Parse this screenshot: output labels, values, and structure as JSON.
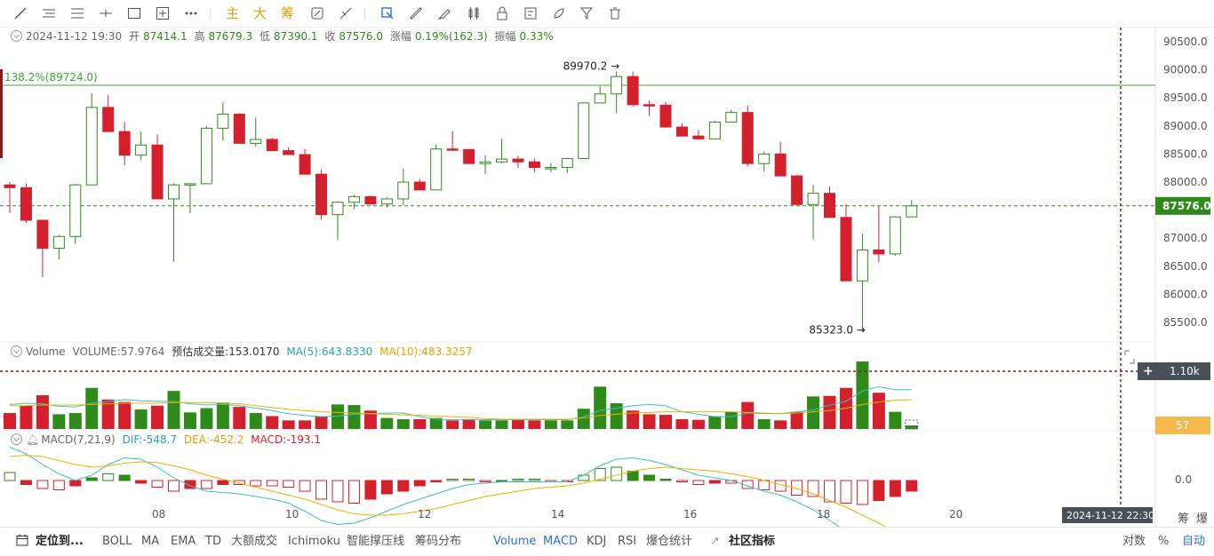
{
  "toolbar": {
    "text_buttons": [
      "主",
      "大",
      "筹"
    ],
    "icons": [
      "line-tool-icon",
      "parallel-lines-icon",
      "horizontal-lines-icon",
      "cross-line-icon",
      "rectangle-icon",
      "plus-box-icon",
      "more-icon",
      "magnet-icon",
      "ruler-icon",
      "cursor-icon",
      "copy-icon",
      "link-icon",
      "brush-icon",
      "candles-icon",
      "lock-icon",
      "edit-icon",
      "highlighter-icon",
      "filter-icon",
      "trash-icon"
    ]
  },
  "ohlc_info": {
    "date": "2024-11-12 19:30",
    "open_label": "开",
    "open": "87414.1",
    "high_label": "高",
    "high": "87679.3",
    "low_label": "低",
    "low": "87390.1",
    "close_label": "收",
    "close": "87576.0",
    "change_label": "涨幅",
    "change": "0.19%(162.3)",
    "amplitude_label": "振幅",
    "amplitude": "0.33%"
  },
  "volume_info": {
    "title": "Volume",
    "volume": "VOLUME:57.9764",
    "estimated": "预估成交量:153.0170",
    "ma5": "MA(5):643.8330",
    "ma10": "MA(10):483.3257"
  },
  "macd_info": {
    "title": "MACD(7,21,9)",
    "dif": "DIF:-548.7",
    "dea": "DEA:-452.2",
    "macd": "MACD:-193.1"
  },
  "price_axis": {
    "ticks": [
      "90500.0",
      "90000.0",
      "89500.0",
      "89000.0",
      "88500.0",
      "88000.0",
      "87500.0",
      "87000.0",
      "86500.0",
      "86000.0",
      "85500.0"
    ],
    "current_price": "87576.0"
  },
  "annotations": {
    "fib_label": "138.2%(89724.0)",
    "high_marker": "89970.2",
    "low_marker": "85323.0"
  },
  "volume_axis": {
    "crosshair_value": "1.10k",
    "current_value": "57"
  },
  "macd_axis": {
    "zero": "0.0"
  },
  "time_axis": {
    "labels": [
      "08",
      "10",
      "12",
      "14",
      "16",
      "18",
      "20"
    ],
    "crosshair_time": "2024-11-12 22:30"
  },
  "right_controls": {
    "chip": "筹",
    "burst": "爆",
    "log": "对数",
    "percent": "%",
    "auto": "自动"
  },
  "bottom_bar": {
    "locate": "定位到...",
    "indicators": [
      "BOLL",
      "MA",
      "EMA",
      "TD",
      "大额成交",
      "Ichimoku",
      "智能撑压线",
      "筹码分布"
    ],
    "sub_indicators": [
      "Volume",
      "MACD",
      "KDJ",
      "RSI",
      "爆仓统计"
    ],
    "community": "社区指标"
  },
  "colors": {
    "up": "#2e8b1a",
    "down": "#d4202c",
    "ma5": "#3bc1c1",
    "ma10": "#f0b000",
    "fib": "#3aaa35",
    "crosshair": "#8b1a1a"
  },
  "chart_data": {
    "type": "candlestick",
    "x_labels": [
      "08",
      "10",
      "12",
      "14",
      "16",
      "18",
      "20"
    ],
    "y_range": [
      85300,
      90600
    ],
    "candles": [
      {
        "o": 87950,
        "h": 88000,
        "l": 87450,
        "c": 87900
      },
      {
        "o": 87900,
        "h": 87970,
        "l": 87270,
        "c": 87320
      },
      {
        "o": 87320,
        "h": 87330,
        "l": 86310,
        "c": 86820
      },
      {
        "o": 86820,
        "h": 87060,
        "l": 86620,
        "c": 87030
      },
      {
        "o": 87030,
        "h": 87970,
        "l": 86900,
        "c": 87950
      },
      {
        "o": 87950,
        "h": 89580,
        "l": 87950,
        "c": 89330
      },
      {
        "o": 89330,
        "h": 89550,
        "l": 88900,
        "c": 88900
      },
      {
        "o": 88900,
        "h": 89070,
        "l": 88300,
        "c": 88480
      },
      {
        "o": 88480,
        "h": 88900,
        "l": 88390,
        "c": 88660
      },
      {
        "o": 88660,
        "h": 88850,
        "l": 87700,
        "c": 87700
      },
      {
        "o": 87700,
        "h": 87980,
        "l": 86580,
        "c": 87950
      },
      {
        "o": 87950,
        "h": 87980,
        "l": 87450,
        "c": 87970
      },
      {
        "o": 87970,
        "h": 89000,
        "l": 87970,
        "c": 88960
      },
      {
        "o": 88960,
        "h": 89430,
        "l": 88740,
        "c": 89210
      },
      {
        "o": 89210,
        "h": 89230,
        "l": 88690,
        "c": 88690
      },
      {
        "o": 88690,
        "h": 89150,
        "l": 88630,
        "c": 88760
      },
      {
        "o": 88760,
        "h": 88790,
        "l": 88560,
        "c": 88560
      },
      {
        "o": 88560,
        "h": 88620,
        "l": 88510,
        "c": 88490
      },
      {
        "o": 88490,
        "h": 88590,
        "l": 88140,
        "c": 88140
      },
      {
        "o": 88140,
        "h": 88220,
        "l": 87330,
        "c": 87420
      },
      {
        "o": 87420,
        "h": 87660,
        "l": 86970,
        "c": 87640
      },
      {
        "o": 87640,
        "h": 87770,
        "l": 87520,
        "c": 87740
      },
      {
        "o": 87740,
        "h": 87760,
        "l": 87600,
        "c": 87610
      },
      {
        "o": 87610,
        "h": 87730,
        "l": 87550,
        "c": 87700
      },
      {
        "o": 87700,
        "h": 88240,
        "l": 87590,
        "c": 88000
      },
      {
        "o": 88000,
        "h": 88050,
        "l": 87850,
        "c": 87860
      },
      {
        "o": 87860,
        "h": 88670,
        "l": 87860,
        "c": 88590
      },
      {
        "o": 88590,
        "h": 88910,
        "l": 88550,
        "c": 88580
      },
      {
        "o": 88580,
        "h": 88580,
        "l": 88330,
        "c": 88330
      },
      {
        "o": 88330,
        "h": 88480,
        "l": 88140,
        "c": 88360
      },
      {
        "o": 88360,
        "h": 88770,
        "l": 88330,
        "c": 88410
      },
      {
        "o": 88410,
        "h": 88470,
        "l": 88250,
        "c": 88360
      },
      {
        "o": 88360,
        "h": 88420,
        "l": 88170,
        "c": 88260
      },
      {
        "o": 88260,
        "h": 88340,
        "l": 88180,
        "c": 88260
      },
      {
        "o": 88260,
        "h": 88430,
        "l": 88160,
        "c": 88420
      },
      {
        "o": 88420,
        "h": 89420,
        "l": 88420,
        "c": 89410
      },
      {
        "o": 89410,
        "h": 89710,
        "l": 89400,
        "c": 89570
      },
      {
        "o": 89570,
        "h": 89970,
        "l": 89230,
        "c": 89880
      },
      {
        "o": 89880,
        "h": 89970,
        "l": 89340,
        "c": 89380
      },
      {
        "o": 89380,
        "h": 89450,
        "l": 89180,
        "c": 89370
      },
      {
        "o": 89370,
        "h": 89430,
        "l": 88970,
        "c": 88980
      },
      {
        "o": 88980,
        "h": 89050,
        "l": 88850,
        "c": 88820
      },
      {
        "o": 88820,
        "h": 88930,
        "l": 88800,
        "c": 88770
      },
      {
        "o": 88770,
        "h": 89090,
        "l": 88770,
        "c": 89070
      },
      {
        "o": 89070,
        "h": 89290,
        "l": 89060,
        "c": 89240
      },
      {
        "o": 89240,
        "h": 89360,
        "l": 88280,
        "c": 88330
      },
      {
        "o": 88330,
        "h": 88550,
        "l": 88190,
        "c": 88500
      },
      {
        "o": 88500,
        "h": 88720,
        "l": 88110,
        "c": 88110
      },
      {
        "o": 88110,
        "h": 88130,
        "l": 87600,
        "c": 87600
      },
      {
        "o": 87600,
        "h": 87950,
        "l": 86980,
        "c": 87800
      },
      {
        "o": 87800,
        "h": 87920,
        "l": 87360,
        "c": 87370
      },
      {
        "o": 87370,
        "h": 87610,
        "l": 86240,
        "c": 86240
      },
      {
        "o": 86240,
        "h": 87080,
        "l": 85330,
        "c": 86790
      },
      {
        "o": 86790,
        "h": 87570,
        "l": 86570,
        "c": 86720
      },
      {
        "o": 86720,
        "h": 87370,
        "l": 86690,
        "c": 87380
      },
      {
        "o": 87380,
        "h": 87680,
        "l": 87390,
        "c": 87576
      }
    ],
    "volume": [
      0.26,
      0.38,
      0.55,
      0.24,
      0.26,
      0.67,
      0.48,
      0.44,
      0.32,
      0.38,
      0.62,
      0.27,
      0.34,
      0.43,
      0.36,
      0.26,
      0.21,
      0.14,
      0.14,
      0.21,
      0.4,
      0.39,
      0.3,
      0.18,
      0.16,
      0.16,
      0.18,
      0.14,
      0.16,
      0.14,
      0.14,
      0.16,
      0.14,
      0.14,
      0.14,
      0.33,
      0.69,
      0.42,
      0.3,
      0.24,
      0.23,
      0.16,
      0.15,
      0.21,
      0.28,
      0.44,
      0.16,
      0.14,
      0.28,
      0.53,
      0.54,
      0.67,
      1.1,
      0.59,
      0.28,
      0.058
    ],
    "volume_ma5": [
      0.4,
      0.42,
      0.41,
      0.37,
      0.36,
      0.42,
      0.45,
      0.48,
      0.46,
      0.45,
      0.45,
      0.41,
      0.39,
      0.4,
      0.38,
      0.34,
      0.3,
      0.25,
      0.22,
      0.2,
      0.21,
      0.24,
      0.25,
      0.26,
      0.26,
      0.2,
      0.16,
      0.15,
      0.15,
      0.15,
      0.15,
      0.15,
      0.15,
      0.15,
      0.15,
      0.2,
      0.3,
      0.34,
      0.38,
      0.4,
      0.38,
      0.28,
      0.24,
      0.2,
      0.2,
      0.26,
      0.25,
      0.25,
      0.28,
      0.31,
      0.39,
      0.45,
      0.62,
      0.69,
      0.64,
      0.64
    ],
    "volume_ma10": [
      0.38,
      0.38,
      0.39,
      0.39,
      0.39,
      0.4,
      0.41,
      0.42,
      0.42,
      0.42,
      0.43,
      0.43,
      0.43,
      0.42,
      0.41,
      0.38,
      0.35,
      0.32,
      0.3,
      0.28,
      0.27,
      0.26,
      0.25,
      0.24,
      0.23,
      0.22,
      0.21,
      0.2,
      0.19,
      0.17,
      0.16,
      0.16,
      0.16,
      0.16,
      0.16,
      0.18,
      0.22,
      0.24,
      0.26,
      0.27,
      0.28,
      0.28,
      0.28,
      0.28,
      0.28,
      0.27,
      0.26,
      0.25,
      0.26,
      0.28,
      0.3,
      0.34,
      0.4,
      0.44,
      0.47,
      0.48
    ],
    "macd_hist": [
      60,
      -30,
      -60,
      -70,
      -40,
      20,
      50,
      40,
      -20,
      -50,
      -80,
      -60,
      -60,
      -30,
      -30,
      -40,
      -40,
      -50,
      -80,
      -140,
      -160,
      -170,
      -140,
      -100,
      -80,
      -40,
      -10,
      10,
      10,
      -10,
      0,
      10,
      10,
      -10,
      -10,
      40,
      90,
      100,
      70,
      40,
      10,
      -10,
      -30,
      -20,
      -20,
      -60,
      -70,
      -80,
      -110,
      -120,
      -160,
      -170,
      -180,
      -150,
      -120,
      -80
    ],
    "macd_dif": [
      250,
      200,
      120,
      50,
      0,
      40,
      120,
      170,
      160,
      100,
      20,
      -40,
      -80,
      -90,
      -100,
      -120,
      -140,
      -170,
      -230,
      -300,
      -330,
      -320,
      -280,
      -230,
      -180,
      -140,
      -100,
      -60,
      -30,
      -20,
      -10,
      -10,
      -10,
      -10,
      -10,
      40,
      110,
      160,
      170,
      150,
      120,
      80,
      40,
      20,
      0,
      -40,
      -80,
      -110,
      -160,
      -220,
      -300,
      -380,
      -450,
      -500,
      -520,
      -549
    ],
    "macd_dea": [
      180,
      190,
      180,
      150,
      120,
      100,
      110,
      130,
      140,
      135,
      110,
      80,
      40,
      10,
      -20,
      -50,
      -80,
      -110,
      -140,
      -180,
      -220,
      -250,
      -260,
      -260,
      -250,
      -230,
      -210,
      -180,
      -150,
      -120,
      -100,
      -80,
      -60,
      -50,
      -40,
      -20,
      10,
      40,
      70,
      90,
      100,
      90,
      80,
      70,
      50,
      30,
      0,
      -30,
      -60,
      -100,
      -150,
      -200,
      -260,
      -320,
      -390,
      -452
    ]
  }
}
